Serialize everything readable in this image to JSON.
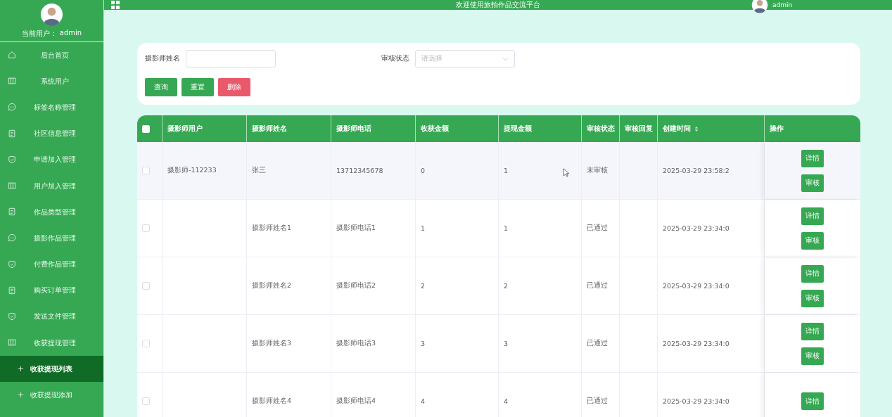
{
  "sidebar": {
    "current_user_label": "当前用户：",
    "current_user": "admin",
    "items": [
      {
        "kind": "home",
        "label": "后台首页",
        "selected": false
      },
      {
        "kind": "columns",
        "label": "系统用户",
        "selected": false
      },
      {
        "kind": "chat",
        "label": "标签名称管理",
        "selected": false
      },
      {
        "kind": "doc",
        "label": "社区信息管理",
        "selected": false
      },
      {
        "kind": "shield",
        "label": "申请加入管理",
        "selected": false
      },
      {
        "kind": "columns",
        "label": "用户加入管理",
        "selected": false
      },
      {
        "kind": "doc",
        "label": "作品类型管理",
        "selected": false
      },
      {
        "kind": "chat",
        "label": "摄影作品管理",
        "selected": false
      },
      {
        "kind": "shield",
        "label": "付费作品管理",
        "selected": false
      },
      {
        "kind": "doc",
        "label": "购买订单管理",
        "selected": false
      },
      {
        "kind": "shield",
        "label": "发送文件管理",
        "selected": false
      },
      {
        "kind": "columns",
        "label": "收获提现管理",
        "selected": false
      },
      {
        "kind": "sub",
        "label": "收获提现列表",
        "selected": true
      },
      {
        "kind": "sub",
        "label": "收获提现添加",
        "selected": false
      }
    ]
  },
  "header": {
    "title": "欢迎使用旅拍作品交流平台",
    "user": "admin"
  },
  "search": {
    "fields": [
      {
        "kind": "input",
        "label": "摄影师姓名"
      },
      {
        "kind": "select",
        "label": "审核状态",
        "placeholder": "请选择"
      }
    ],
    "buttons": [
      {
        "kind": "primary",
        "label": "查询"
      },
      {
        "kind": "primary",
        "label": "重置"
      },
      {
        "kind": "danger",
        "label": "删除"
      }
    ]
  },
  "table": {
    "header_checked": false,
    "columns": [
      {
        "label": "摄影师用户",
        "sortable": false
      },
      {
        "label": "摄影师姓名",
        "sortable": false
      },
      {
        "label": "摄影师电话",
        "sortable": false
      },
      {
        "label": "收获金额",
        "sortable": false
      },
      {
        "label": "提现金额",
        "sortable": false
      },
      {
        "label": "审核状态",
        "sortable": false
      },
      {
        "label": "审核回复",
        "sortable": false
      },
      {
        "label": "创建时间",
        "sortable": true
      },
      {
        "label": "操作",
        "sortable": false
      }
    ],
    "rows": [
      {
        "hovered": true,
        "checked": false,
        "cells": [
          "摄影师-112233",
          "张三",
          "13712345678",
          "0",
          "1",
          "未审核",
          "",
          "2025-03-29 23:58:2"
        ],
        "actions": [
          "详情",
          "审核"
        ]
      },
      {
        "hovered": false,
        "checked": false,
        "cells": [
          "",
          "摄影师姓名1",
          "摄影师电话1",
          "1",
          "1",
          "已通过",
          "",
          "2025-03-29 23:34:0"
        ],
        "actions": [
          "详情",
          "审核"
        ]
      },
      {
        "hovered": false,
        "checked": false,
        "cells": [
          "",
          "摄影师姓名2",
          "摄影师电话2",
          "2",
          "2",
          "已通过",
          "",
          "2025-03-29 23:34:0"
        ],
        "actions": [
          "详情",
          "审核"
        ]
      },
      {
        "hovered": false,
        "checked": false,
        "cells": [
          "",
          "摄影师姓名3",
          "摄影师电话3",
          "3",
          "3",
          "已通过",
          "",
          "2025-03-29 23:34:0"
        ],
        "actions": [
          "详情",
          "审核"
        ]
      },
      {
        "hovered": false,
        "checked": false,
        "cells": [
          "",
          "摄影师姓名4",
          "摄影师电话4",
          "4",
          "4",
          "已通过",
          "",
          "2025-03-29 23:34:0"
        ],
        "actions": [
          "详情"
        ]
      }
    ]
  }
}
